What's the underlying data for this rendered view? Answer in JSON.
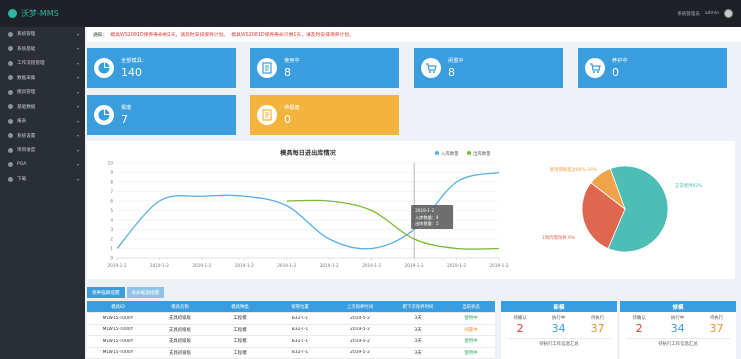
{
  "app": {
    "title": "沃梦-MMS",
    "user": "系统管理员",
    "admin": "admin"
  },
  "sidebar": {
    "items": [
      {
        "label": "系统管理"
      },
      {
        "label": "系统基础"
      },
      {
        "label": "工作流程管理"
      },
      {
        "label": "数据采集"
      },
      {
        "label": "模具管理"
      },
      {
        "label": "基础数据"
      },
      {
        "label": "报表"
      },
      {
        "label": "系统设置"
      },
      {
        "label": "项目进度"
      },
      {
        "label": "POA"
      },
      {
        "label": "下载"
      }
    ]
  },
  "notice": {
    "label": "通知：",
    "messages": [
      "模具WS2081D保养寿命剩1天，请及时安排保养计划。",
      "模具WS2081D保养寿命只剩1天，请及时安排保养计划。"
    ]
  },
  "stats": [
    {
      "label": "全部模具：",
      "value": "140",
      "color": "blue",
      "icon": "pie-chart-icon"
    },
    {
      "label": "使用中",
      "value": "8",
      "color": "blue",
      "icon": "document-icon"
    },
    {
      "label": "闲置中",
      "value": "8",
      "color": "blue",
      "icon": "cart-icon"
    },
    {
      "label": "养护中",
      "value": "0",
      "color": "blue",
      "icon": "cart-icon"
    },
    {
      "label": "报废",
      "value": "7",
      "color": "blue",
      "icon": "pie-chart-icon"
    },
    {
      "label": "待报废",
      "value": "0",
      "color": "yellow",
      "icon": "document-icon"
    }
  ],
  "chart_data": [
    {
      "type": "line",
      "title": "模具每日进出库情况",
      "series": [
        {
          "name": "入库数量",
          "color": "#5aaee0",
          "values": [
            1,
            6,
            6.5,
            6.5,
            5.5,
            2,
            1,
            3,
            8,
            9
          ]
        },
        {
          "name": "出库数量",
          "color": "#7cb833",
          "values": [
            null,
            null,
            null,
            null,
            6,
            6,
            5,
            2,
            1,
            1
          ]
        }
      ],
      "categories": [
        "2019-1-2",
        "2019-1-2",
        "2019-1-2",
        "2019-1-2",
        "2019-1-2",
        "2019-1-2",
        "2019-1-2",
        "2019-1-2",
        "2019-1-2",
        "2019-1-2"
      ],
      "ylim": [
        0,
        10
      ],
      "yticks": [
        0,
        1,
        2,
        3,
        4,
        5,
        6,
        7,
        8,
        9,
        10
      ],
      "tooltip": {
        "title": "2019-1-2",
        "lines": [
          "入库数量：4",
          "出库数量：5"
        ]
      },
      "grid": true,
      "legend": "top-right"
    },
    {
      "type": "pie",
      "slices": [
        {
          "name": "正常使用",
          "value": 62,
          "color": "#4dbdb6",
          "label": "正常使用62%"
        },
        {
          "name": "1周内需保养",
          "value": 29,
          "color": "#e0674f",
          "label": "1周内需保养 9%"
        },
        {
          "name": "使用期限超过80%",
          "value": 9,
          "color": "#f0a34b",
          "label": "使用期限超过80%-29%"
        }
      ]
    }
  ],
  "tabs": [
    {
      "label": "保养临期提醒"
    },
    {
      "label": "寿命临期提醒"
    }
  ],
  "table": {
    "headers": [
      "模具ID",
      "模具名称",
      "模具种类",
      "保管位置",
      "上次保养时间",
      "距下次保养时间",
      "当前状态"
    ],
    "rows": [
      [
        "MLW15-T000Y",
        "支具初级板",
        "工程模",
        "B32-T-1",
        "2019-5-2",
        "3天",
        "使用中"
      ],
      [
        "MLW15-T000Y",
        "支具初级板",
        "工程模",
        "B32-T-1",
        "2019-5-2",
        "3天",
        "闲置中"
      ],
      [
        "MLW15-T000Y",
        "支具初级板",
        "工程模",
        "B32-T-1",
        "2019-5-2",
        "3天",
        "使用中"
      ],
      [
        "MLW15-T000Y",
        "支具初级板",
        "工程模",
        "B32-T-1",
        "2019-5-2",
        "3天",
        "使用中"
      ]
    ]
  },
  "panels": [
    {
      "title": "新模",
      "stats": [
        {
          "label": "待确认",
          "value": "2",
          "color": "#e23b3b"
        },
        {
          "label": "执行中",
          "value": "34",
          "color": "#3a9ddd"
        },
        {
          "label": "待执行",
          "value": "37",
          "color": "#f0902a"
        }
      ],
      "footer": "待执行工作信息汇总"
    },
    {
      "title": "修模",
      "stats": [
        {
          "label": "待确认",
          "value": "2",
          "color": "#e23b3b"
        },
        {
          "label": "执行中",
          "value": "34",
          "color": "#3a9ddd"
        },
        {
          "label": "待执行",
          "value": "37",
          "color": "#f0902a"
        }
      ],
      "footer": "待执行工作信息汇总"
    }
  ]
}
